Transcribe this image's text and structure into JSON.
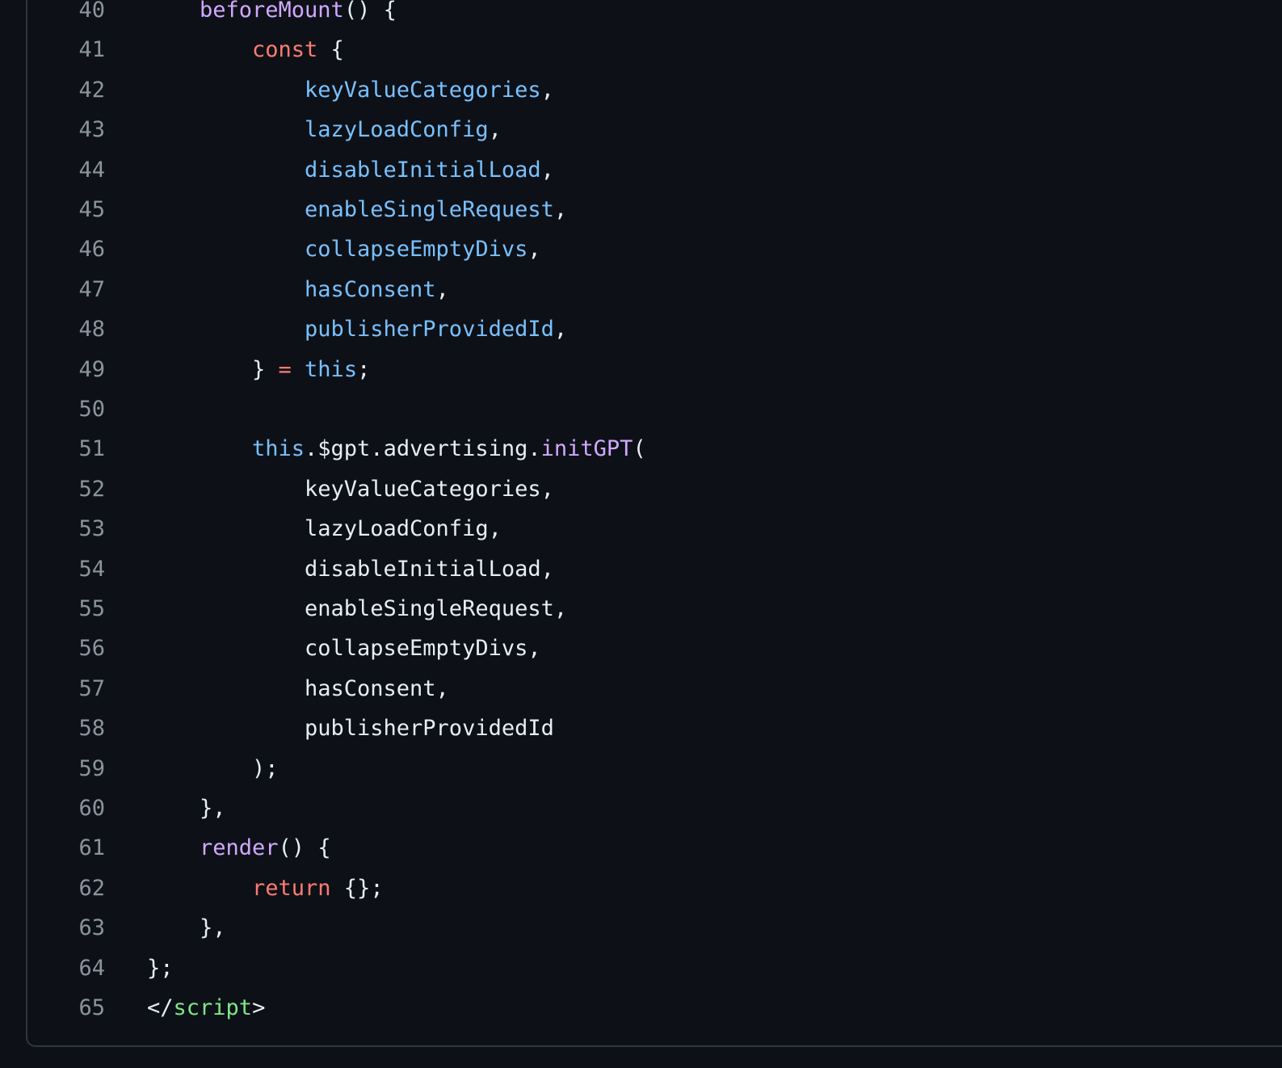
{
  "code_lines": [
    {
      "num": "40",
      "indent": 1,
      "tokens": [
        {
          "t": "beforeMount",
          "c": "fn"
        },
        {
          "t": "() {",
          "c": "pl"
        }
      ]
    },
    {
      "num": "41",
      "indent": 2,
      "tokens": [
        {
          "t": "const",
          "c": "kw"
        },
        {
          "t": " {",
          "c": "pl"
        }
      ]
    },
    {
      "num": "42",
      "indent": 3,
      "tokens": [
        {
          "t": "keyValueCategories",
          "c": "var"
        },
        {
          "t": ",",
          "c": "pl"
        }
      ]
    },
    {
      "num": "43",
      "indent": 3,
      "tokens": [
        {
          "t": "lazyLoadConfig",
          "c": "var"
        },
        {
          "t": ",",
          "c": "pl"
        }
      ]
    },
    {
      "num": "44",
      "indent": 3,
      "tokens": [
        {
          "t": "disableInitialLoad",
          "c": "var"
        },
        {
          "t": ",",
          "c": "pl"
        }
      ]
    },
    {
      "num": "45",
      "indent": 3,
      "tokens": [
        {
          "t": "enableSingleRequest",
          "c": "var"
        },
        {
          "t": ",",
          "c": "pl"
        }
      ]
    },
    {
      "num": "46",
      "indent": 3,
      "tokens": [
        {
          "t": "collapseEmptyDivs",
          "c": "var"
        },
        {
          "t": ",",
          "c": "pl"
        }
      ]
    },
    {
      "num": "47",
      "indent": 3,
      "tokens": [
        {
          "t": "hasConsent",
          "c": "var"
        },
        {
          "t": ",",
          "c": "pl"
        }
      ]
    },
    {
      "num": "48",
      "indent": 3,
      "tokens": [
        {
          "t": "publisherProvidedId",
          "c": "var"
        },
        {
          "t": ",",
          "c": "pl"
        }
      ]
    },
    {
      "num": "49",
      "indent": 2,
      "tokens": [
        {
          "t": "} ",
          "c": "pl"
        },
        {
          "t": "=",
          "c": "kw"
        },
        {
          "t": " ",
          "c": "pl"
        },
        {
          "t": "this",
          "c": "var"
        },
        {
          "t": ";",
          "c": "pl"
        }
      ]
    },
    {
      "num": "50",
      "indent": 0,
      "tokens": []
    },
    {
      "num": "51",
      "indent": 2,
      "tokens": [
        {
          "t": "this",
          "c": "var"
        },
        {
          "t": ".$gpt.advertising.",
          "c": "pl"
        },
        {
          "t": "initGPT",
          "c": "fn"
        },
        {
          "t": "(",
          "c": "pl"
        }
      ]
    },
    {
      "num": "52",
      "indent": 3,
      "tokens": [
        {
          "t": "keyValueCategories,",
          "c": "pl"
        }
      ]
    },
    {
      "num": "53",
      "indent": 3,
      "tokens": [
        {
          "t": "lazyLoadConfig,",
          "c": "pl"
        }
      ]
    },
    {
      "num": "54",
      "indent": 3,
      "tokens": [
        {
          "t": "disableInitialLoad,",
          "c": "pl"
        }
      ]
    },
    {
      "num": "55",
      "indent": 3,
      "tokens": [
        {
          "t": "enableSingleRequest,",
          "c": "pl"
        }
      ]
    },
    {
      "num": "56",
      "indent": 3,
      "tokens": [
        {
          "t": "collapseEmptyDivs,",
          "c": "pl"
        }
      ]
    },
    {
      "num": "57",
      "indent": 3,
      "tokens": [
        {
          "t": "hasConsent,",
          "c": "pl"
        }
      ]
    },
    {
      "num": "58",
      "indent": 3,
      "tokens": [
        {
          "t": "publisherProvidedId",
          "c": "pl"
        }
      ]
    },
    {
      "num": "59",
      "indent": 2,
      "tokens": [
        {
          "t": ");",
          "c": "pl"
        }
      ]
    },
    {
      "num": "60",
      "indent": 1,
      "tokens": [
        {
          "t": "},",
          "c": "pl"
        }
      ]
    },
    {
      "num": "61",
      "indent": 1,
      "tokens": [
        {
          "t": "render",
          "c": "fn"
        },
        {
          "t": "() {",
          "c": "pl"
        }
      ]
    },
    {
      "num": "62",
      "indent": 2,
      "tokens": [
        {
          "t": "return",
          "c": "kw"
        },
        {
          "t": " {};",
          "c": "pl"
        }
      ]
    },
    {
      "num": "63",
      "indent": 1,
      "tokens": [
        {
          "t": "},",
          "c": "pl"
        }
      ]
    },
    {
      "num": "64",
      "indent": 0,
      "tokens": [
        {
          "t": "};",
          "c": "pl"
        }
      ]
    },
    {
      "num": "65",
      "indent": 0,
      "tokens": [
        {
          "t": "</",
          "c": "pl"
        },
        {
          "t": "script",
          "c": "tag"
        },
        {
          "t": ">",
          "c": "pl"
        }
      ]
    }
  ],
  "colors": {
    "background": "#0d1117",
    "line_number": "#8b949e",
    "keyword": "#ff7b72",
    "function": "#d2a8ff",
    "variable": "#79c0ff",
    "tag": "#7ee787",
    "plain": "#e6edf3"
  }
}
